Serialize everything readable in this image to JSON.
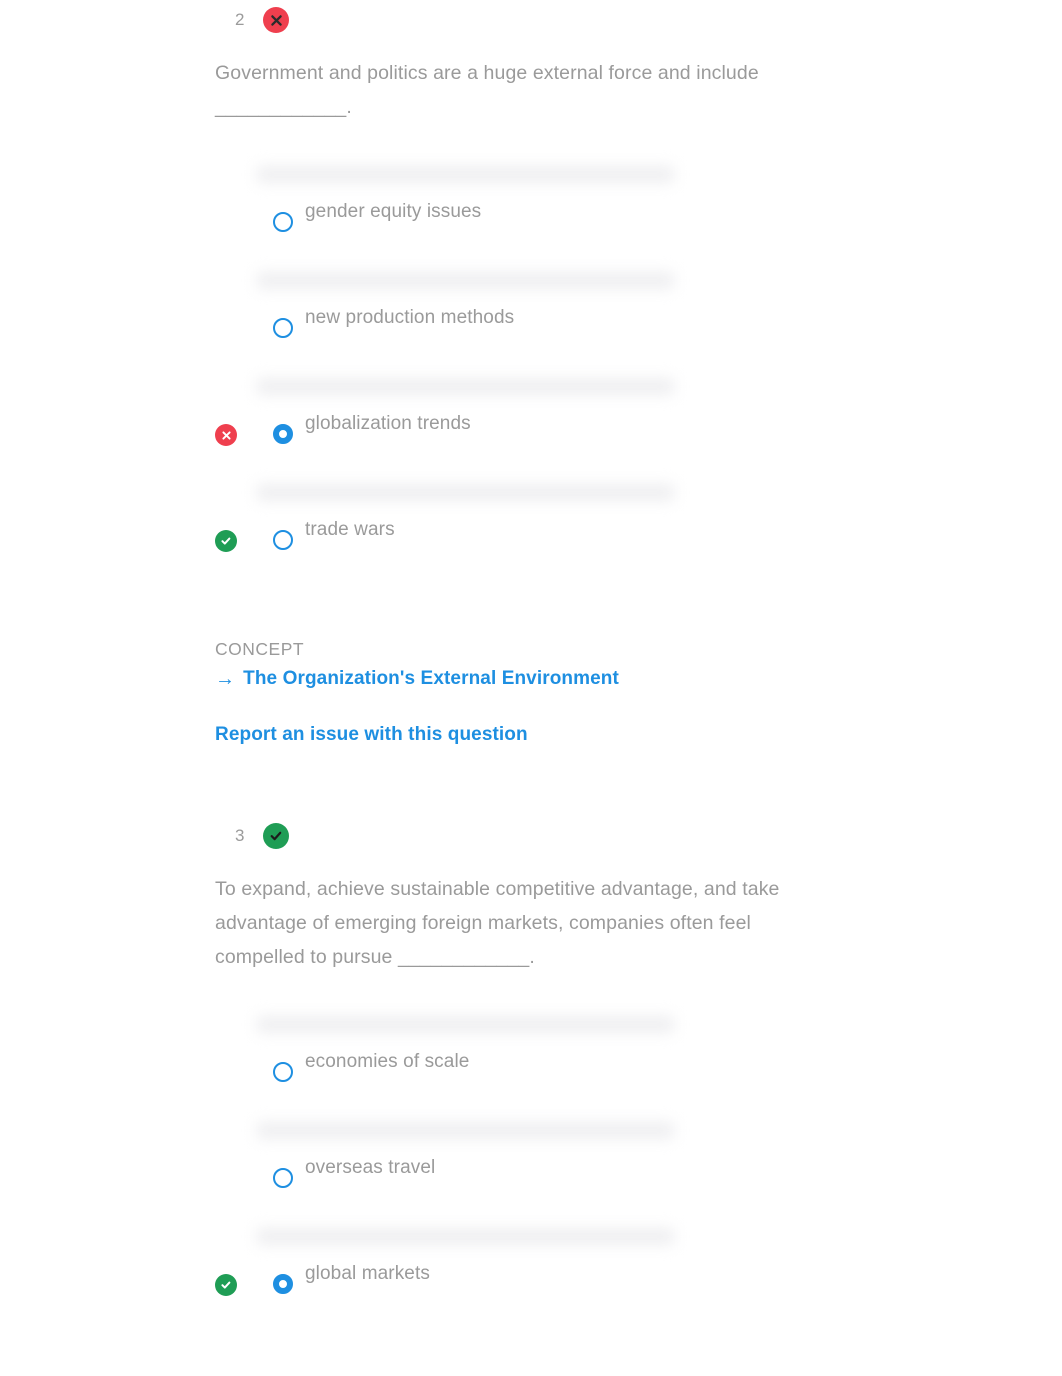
{
  "questions": [
    {
      "number": "2",
      "status": "wrong",
      "status_icon": "x-circle-icon",
      "text": "Government and politics are a huge external force and include ____________.",
      "options": [
        {
          "label": "gender equity issues",
          "selected": false,
          "marker": "none"
        },
        {
          "label": "new production methods",
          "selected": false,
          "marker": "none"
        },
        {
          "label": "globalization trends",
          "selected": true,
          "marker": "wrong"
        },
        {
          "label": "trade wars",
          "selected": false,
          "marker": "right"
        }
      ],
      "concept_heading": "CONCEPT",
      "concept_link": "The Organization's External Environment",
      "report_link": "Report an issue with this question"
    },
    {
      "number": "3",
      "status": "right",
      "status_icon": "check-circle-icon",
      "text": "To expand, achieve sustainable competitive advantage, and take advantage of emerging foreign markets, companies often feel compelled to pursue ____________.",
      "options": [
        {
          "label": "economies of scale",
          "selected": false,
          "marker": "none"
        },
        {
          "label": "overseas travel",
          "selected": false,
          "marker": "none"
        },
        {
          "label": "global markets",
          "selected": true,
          "marker": "right"
        }
      ]
    }
  ],
  "colors": {
    "wrong": "#ef3f4e",
    "right": "#1f9d55",
    "link": "#1e8fe1",
    "text": "#9a9a9a"
  }
}
